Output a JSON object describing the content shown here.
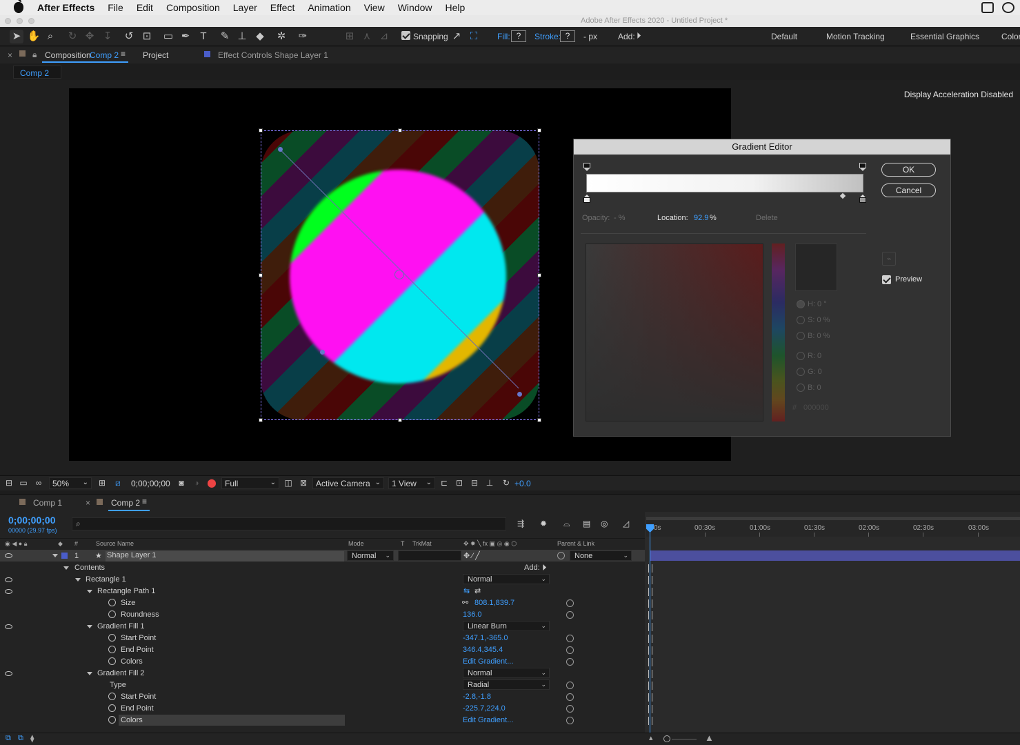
{
  "menubar": {
    "app_name": "After Effects",
    "items": [
      "File",
      "Edit",
      "Composition",
      "Layer",
      "Effect",
      "Animation",
      "View",
      "Window",
      "Help"
    ]
  },
  "window": {
    "title": "Adobe After Effects 2020 - Untitled Project *"
  },
  "toolbar": {
    "snapping_label": "Snapping",
    "fill_label": "Fill:",
    "fill_value": "?",
    "stroke_label": "Stroke:",
    "stroke_value": "?",
    "stroke_px": "- px",
    "add_label": "Add:",
    "workspaces": [
      "Default",
      "Motion Tracking",
      "Essential Graphics",
      "Color"
    ]
  },
  "panels": {
    "composition_label": "Composition",
    "composition_name": "Comp 2",
    "project_label": "Project",
    "effect_controls_label": "Effect Controls Shape Layer 1",
    "subtab": "Comp 2",
    "display_accel": "Display Acceleration Disabled"
  },
  "gradient_editor": {
    "title": "Gradient Editor",
    "ok": "OK",
    "cancel": "Cancel",
    "opacity_label": "Opacity:",
    "opacity_value": "- %",
    "location_label": "Location:",
    "location_value": "92.9",
    "location_unit": "%",
    "delete_label": "Delete",
    "preview_label": "Preview",
    "h": "H: 0 °",
    "s": "S: 0 %",
    "b": "B: 0 %",
    "r": "R: 0",
    "g": "G: 0",
    "b2": "B: 0",
    "hex_prefix": "#",
    "hex_value": "000000"
  },
  "viewer_bar": {
    "zoom": "50%",
    "timecode": "0;00;00;00",
    "resolution": "Full",
    "camera": "Active Camera",
    "views": "1 View",
    "exposure": "+0.0"
  },
  "timeline": {
    "tabs": [
      "Comp 1",
      "Comp 2"
    ],
    "timecode": "0;00;00;00",
    "fps": "00000 (29.97 fps)",
    "ruler": [
      "0s",
      "00:30s",
      "01:00s",
      "01:30s",
      "02:00s",
      "02:30s",
      "03:00s"
    ],
    "columns": {
      "hash": "#",
      "source_name": "Source Name",
      "mode": "Mode",
      "t": "T",
      "trkmat": "TrkMat",
      "parent": "Parent & Link"
    },
    "layer": {
      "index": "1",
      "name": "Shape Layer 1",
      "mode": "Normal",
      "parent": "None"
    },
    "add_label": "Add:",
    "rows": {
      "contents": "Contents",
      "rect1": "Rectangle 1",
      "rect1_mode": "Normal",
      "rect_path": "Rectangle Path 1",
      "size": "Size",
      "size_val": "808.1,839.7",
      "roundness": "Roundness",
      "roundness_val": "136.0",
      "gf1": "Gradient Fill 1",
      "gf1_mode": "Linear Burn",
      "gf1_start": "Start Point",
      "gf1_start_val": "-347.1,-365.0",
      "gf1_end": "End Point",
      "gf1_end_val": "346.4,345.4",
      "gf1_colors": "Colors",
      "gf1_colors_val": "Edit Gradient...",
      "gf2": "Gradient Fill 2",
      "gf2_mode": "Normal",
      "gf2_type": "Type",
      "gf2_type_val": "Radial",
      "gf2_start": "Start Point",
      "gf2_start_val": "-2.8,-1.8",
      "gf2_end": "End Point",
      "gf2_end_val": "-225.7,224.0",
      "gf2_colors": "Colors",
      "gf2_colors_val": "Edit Gradient..."
    }
  }
}
